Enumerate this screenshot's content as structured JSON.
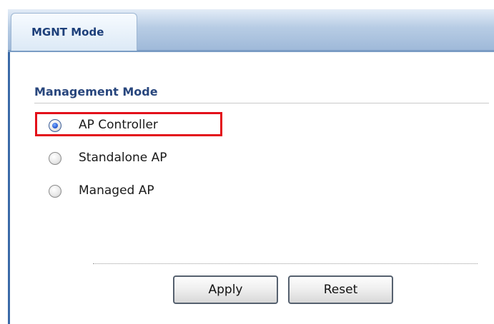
{
  "tab": {
    "label": "MGNT Mode"
  },
  "section": {
    "title": "Management Mode"
  },
  "options": [
    {
      "label": "AP Controller",
      "checked": true
    },
    {
      "label": "Standalone AP",
      "checked": false
    },
    {
      "label": "Managed AP",
      "checked": false
    }
  ],
  "buttons": {
    "apply": "Apply",
    "reset": "Reset"
  },
  "colors": {
    "highlight": "#e3101a",
    "tab_text": "#1d3f7a",
    "title_text": "#28467d"
  }
}
